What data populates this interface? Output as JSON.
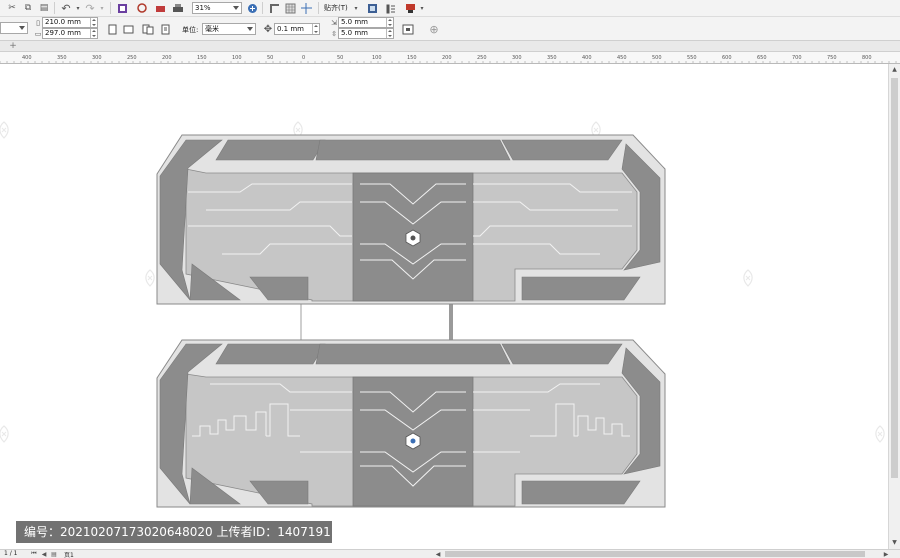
{
  "toolbar1": {
    "zoom_value": "31%",
    "align_label": "贴齐(T)",
    "icons": [
      "cut-icon",
      "copy-icon",
      "paste-icon",
      "undo-icon",
      "redo-icon",
      "import-icon",
      "export-icon",
      "publish-icon",
      "print-icon",
      "zoom-dropdown",
      "full-screen-icon",
      "rulers-icon",
      "grid-icon",
      "guidelines-icon",
      "snap-icon",
      "options-icon",
      "launch-icon"
    ]
  },
  "toolbar2": {
    "page_width": "210.0 mm",
    "page_height": "297.0 mm",
    "units_label": "单位:",
    "units_value": "毫米",
    "nudge_value": "0.1 mm",
    "dup_x": "5.0 mm",
    "dup_y": "5.0 mm"
  },
  "ruler": {
    "ticks": [
      "400",
      "350",
      "300",
      "250",
      "200",
      "150",
      "100",
      "50",
      "0",
      "50",
      "100",
      "150",
      "200",
      "250",
      "300",
      "350",
      "400",
      "450",
      "500",
      "550",
      "600",
      "650",
      "700",
      "750",
      "800"
    ],
    "unit": "毫米"
  },
  "status": {
    "page_info": "1 / 1",
    "page_tab": "页1"
  },
  "watermark": {
    "text": "编号：20210207173020648020 上传者ID：1407191"
  },
  "colors": {
    "toolbar_bg": "#f3f3f3",
    "panel_dark": "#8c8c8c",
    "panel_mid": "#a6a6a6",
    "panel_light": "#c6c6c6",
    "panel_frame": "#e3e3e3",
    "panel_outline": "#8a8a8a",
    "circuit_line": "#f2f2f2"
  }
}
